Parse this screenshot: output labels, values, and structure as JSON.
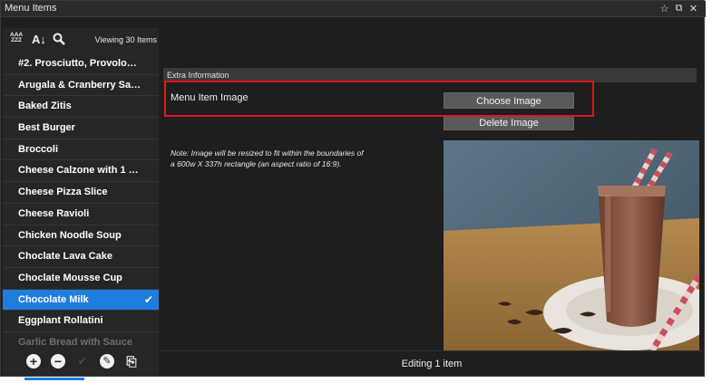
{
  "window": {
    "title": "Menu Items",
    "controls": [
      "☆",
      "⧉",
      "✕"
    ]
  },
  "toolbar": {
    "sort_az_top": "AAA",
    "sort_az_bottom": "ZZZ",
    "sort_icon": "↓",
    "search_icon": "🔍",
    "viewing_text": "Viewing 30 Items"
  },
  "items": [
    "#2. Prosciutto, Provolo…",
    "Arugala & Cranberry Sa…",
    "Baked Zitis",
    "Best Burger",
    "Broccoli",
    "Cheese Calzone with 1 …",
    "Cheese Pizza Slice",
    "Cheese Ravioli",
    "Chicken Noodle Soup",
    "Choclate Lava Cake",
    "Choclate Mousse Cup",
    "Chocolate Milk",
    "Eggplant Rollatini",
    "Garlic Bread with Sauce"
  ],
  "selected_item": "Chocolate Milk",
  "bottom_actions": {
    "add": "+",
    "remove": "−",
    "confirm": "✔",
    "edit": "✎",
    "copy": "⎘"
  },
  "section": {
    "header": "Extra Information",
    "field_label": "Menu Item Image",
    "choose_button": "Choose Image",
    "delete_button": "Delete Image",
    "note": "Note: Image will be resized to fit within the boundaries of a 600w X 337h rectangle (an aspect ratio of 16:9)."
  },
  "status": {
    "text": "Editing 1 item"
  },
  "colors": {
    "accent": "#1f7de0",
    "highlight_box": "#e3151a",
    "background": "#1e1e1e"
  }
}
